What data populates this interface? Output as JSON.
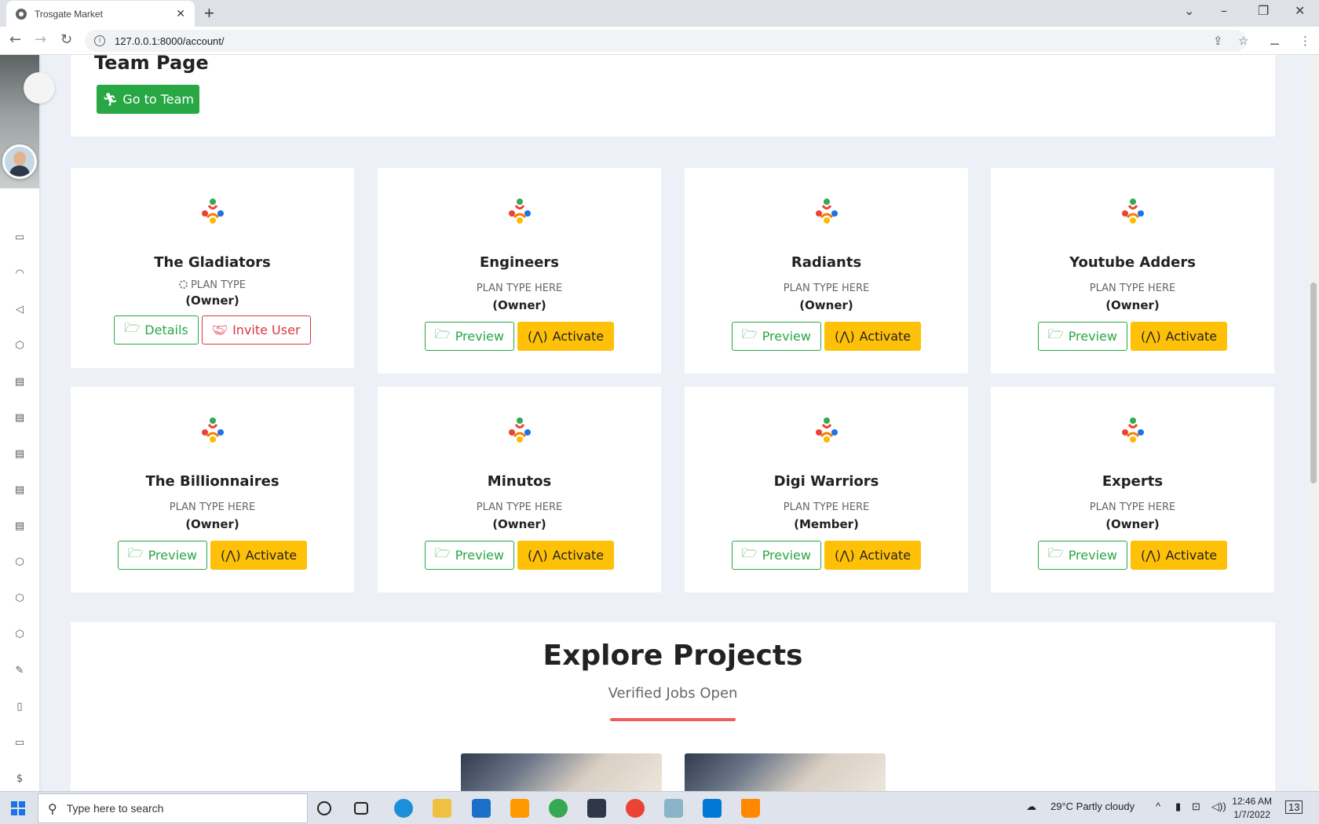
{
  "browser": {
    "tab_title": "Trosgate Market",
    "tab_close": "✕",
    "new_tab": "+",
    "url": "127.0.0.1:8000/account/"
  },
  "team_page": {
    "heading": "Team Page",
    "go_to_team_label": "Go to Team"
  },
  "teams": [
    {
      "name": "The Gladiators",
      "plan": "PLAN TYPE",
      "role": "(Owner)",
      "primary_label": "Details",
      "secondary_label": "Invite User",
      "loading": true
    },
    {
      "name": "Engineers",
      "plan": "PLAN TYPE HERE",
      "role": "(Owner)",
      "primary_label": "Preview",
      "secondary_label": "Activate"
    },
    {
      "name": "Radiants",
      "plan": "PLAN TYPE HERE",
      "role": "(Owner)",
      "primary_label": "Preview",
      "secondary_label": "Activate"
    },
    {
      "name": "Youtube Adders",
      "plan": "PLAN TYPE HERE",
      "role": "(Owner)",
      "primary_label": "Preview",
      "secondary_label": "Activate"
    },
    {
      "name": "The Billionnaires",
      "plan": "PLAN TYPE HERE",
      "role": "(Owner)",
      "primary_label": "Preview",
      "secondary_label": "Activate"
    },
    {
      "name": "Minutos",
      "plan": "PLAN TYPE HERE",
      "role": "(Owner)",
      "primary_label": "Preview",
      "secondary_label": "Activate"
    },
    {
      "name": "Digi Warriors",
      "plan": "PLAN TYPE HERE",
      "role": "(Member)",
      "primary_label": "Preview",
      "secondary_label": "Activate"
    },
    {
      "name": "Experts",
      "plan": "PLAN TYPE HERE",
      "role": "(Owner)",
      "primary_label": "Preview",
      "secondary_label": "Activate"
    }
  ],
  "explore": {
    "title": "Explore Projects",
    "subtitle": "Verified Jobs Open"
  },
  "taskbar": {
    "search_placeholder": "Type here to search",
    "weather": "29°C  Partly cloudy",
    "time": "12:46 AM",
    "date": "1/7/2022",
    "notifications": "13"
  },
  "colors": {
    "green": "#28a745",
    "red": "#dc3545",
    "yellow": "#ffc107",
    "accent_divider": "#f35b5b"
  }
}
